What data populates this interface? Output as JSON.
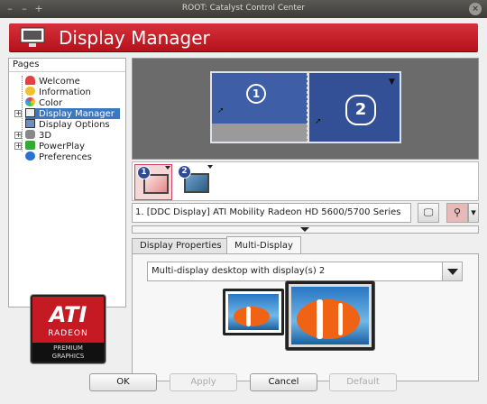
{
  "window": {
    "title": "ROOT: Catalyst Control Center"
  },
  "banner": {
    "title": "Display Manager"
  },
  "nav": {
    "header": "Pages",
    "items": [
      {
        "label": "Welcome",
        "icon": "welcome-icon"
      },
      {
        "label": "Information",
        "icon": "info-icon"
      },
      {
        "label": "Color",
        "icon": "color-wheel-icon"
      },
      {
        "label": "Display Manager",
        "icon": "display-manager-icon",
        "selected": true
      },
      {
        "label": "Display Options",
        "icon": "display-options-icon"
      },
      {
        "label": "3D",
        "icon": "3d-icon"
      },
      {
        "label": "PowerPlay",
        "icon": "powerplay-icon"
      },
      {
        "label": "Preferences",
        "icon": "preferences-icon"
      }
    ]
  },
  "logo": {
    "brand": "ATI",
    "line": "RADEON",
    "band1": "PREMIUM",
    "band2": "GRAPHICS"
  },
  "preview": {
    "display1": "1",
    "display2": "2"
  },
  "thumbs": [
    {
      "badge": "1"
    },
    {
      "badge": "2"
    }
  ],
  "device": {
    "selected": "1.  [DDC Display] ATI Mobility Radeon HD 5600/5700 Series"
  },
  "tabs": {
    "properties": "Display Properties",
    "multi": "Multi-Display"
  },
  "multi": {
    "mode": "Multi-display desktop with display(s) 2"
  },
  "buttons": {
    "ok": "OK",
    "apply": "Apply",
    "cancel": "Cancel",
    "default": "Default"
  },
  "colors": {
    "accent": "#c51a24",
    "selection": "#3a78c3",
    "desktop": "#3e5ea8"
  }
}
